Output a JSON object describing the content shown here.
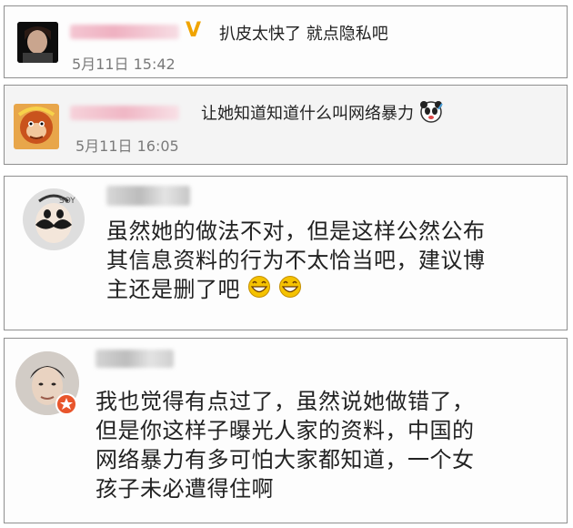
{
  "comments": [
    {
      "text": "扒皮太快了 就点隐私吧",
      "time": "5月11日 15:42",
      "badge": "V"
    },
    {
      "text": "让她知道知道什么叫网络暴力",
      "time": "5月11日 16:05"
    },
    {
      "lines": [
        "虽然她的做法不对，但是这样公然公布",
        "其信息资料的行为不太恰当吧，建议博",
        "主还是删了吧"
      ]
    },
    {
      "lines": [
        "我也觉得有点过了，虽然说她做错了，",
        "但是你这样子曝光人家的资料，中国的",
        "网络暴力有多可怕大家都知道，一个女",
        "孩子未必遭得住啊"
      ]
    }
  ],
  "colors": {
    "badge_v": "#f0a400",
    "emoji_yellow": "#f5c200",
    "avatar_badge": "#e8552c"
  },
  "icons": [
    "panda-face-icon",
    "grin-emoji-icon",
    "star-badge-icon"
  ]
}
